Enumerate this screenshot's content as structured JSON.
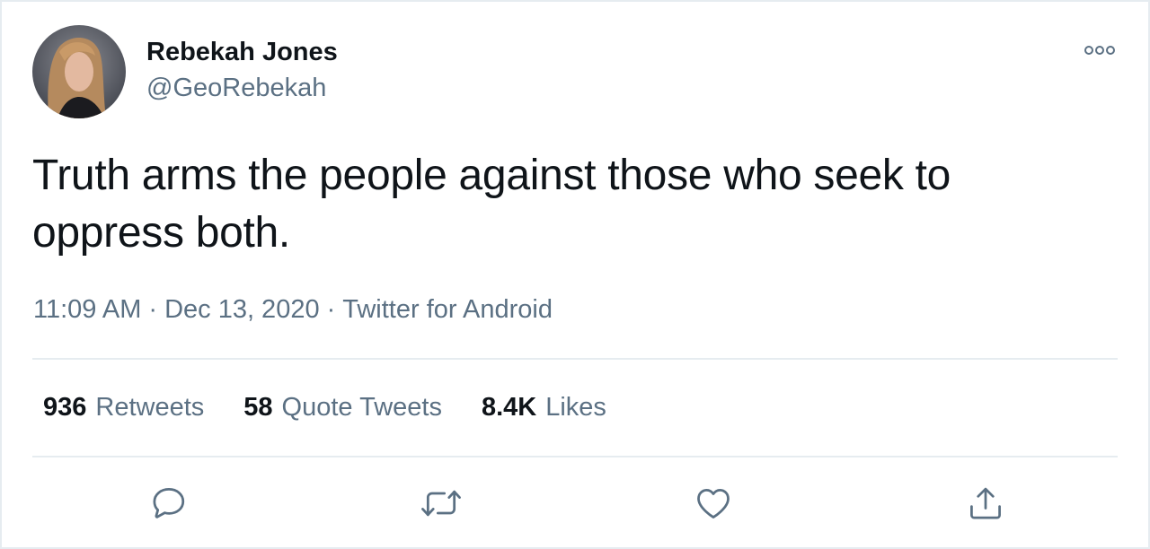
{
  "author": {
    "display_name": "Rebekah Jones",
    "handle": "@GeoRebekah"
  },
  "tweet": {
    "text": "Truth arms the people against those who seek to oppress both.",
    "time": "11:09 AM",
    "date": "Dec 13, 2020",
    "source": "Twitter for Android",
    "separator": "·"
  },
  "stats": [
    {
      "count": "936",
      "label": "Retweets"
    },
    {
      "count": "58",
      "label": "Quote Tweets"
    },
    {
      "count": "8.4K",
      "label": "Likes"
    }
  ],
  "actions": [
    {
      "icon": "reply-icon"
    },
    {
      "icon": "retweet-icon"
    },
    {
      "icon": "like-icon"
    },
    {
      "icon": "share-icon"
    }
  ],
  "colors": {
    "text_primary": "#0f1419",
    "text_secondary": "#5b7083",
    "border": "#e6ecf0",
    "icon": "#5b7083"
  }
}
